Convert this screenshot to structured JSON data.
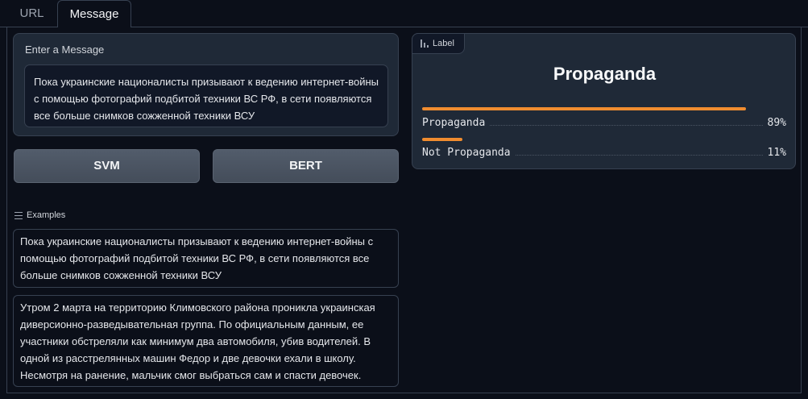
{
  "tabs": [
    {
      "label": "URL",
      "active": false
    },
    {
      "label": "Message",
      "active": true
    }
  ],
  "input": {
    "label": "Enter a Message",
    "value": "Пока украинские националисты призывают к ведению интернет-войны с помощью фотографий подбитой техники ВС РФ, в сети появляются все больше снимков сожженной техники ВСУ"
  },
  "buttons": {
    "svm": "SVM",
    "bert": "BERT"
  },
  "examples": {
    "header": "Examples",
    "items": [
      "Пока украинские националисты призывают к ведению интернет-войны с помощью фотографий подбитой техники ВС РФ, в сети появляются все больше снимков сожженной техники ВСУ",
      "Утром 2 марта на территорию Климовского района проникла украинская диверсионно-разведывательная группа. По официальным данным, ее участники обстреляли как минимум два автомобиля, убив водителей. В одной из расстрелянных машин Федор и две девочки ехали в школу. Несмотря на ранение, мальчик смог выбраться сам и спасти девочек."
    ]
  },
  "output": {
    "tag": "Label",
    "prediction": "Propaganda",
    "bar_color": "#f08c2f",
    "confidences": [
      {
        "label": "Propaganda",
        "value": 0.89,
        "display": "89%"
      },
      {
        "label": "Not Propaganda",
        "value": 0.11,
        "display": "11%"
      }
    ]
  }
}
